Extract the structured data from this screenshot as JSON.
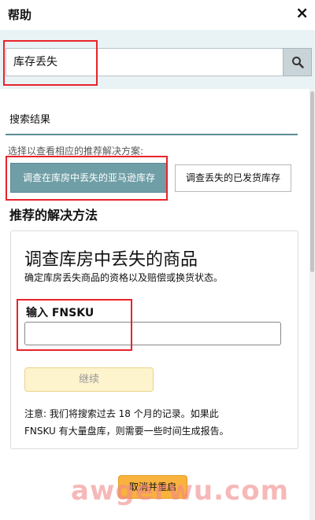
{
  "window": {
    "title": "帮助",
    "close_glyph": "×"
  },
  "search": {
    "value": "库存丢失",
    "icon": "search-icon"
  },
  "results": {
    "label": "搜索结果",
    "hint": "选择以查看相应的推荐解决方案:",
    "options": [
      {
        "label": "调查在库房中丢失的亚马逊库存",
        "selected": true
      },
      {
        "label": "调查丢失的已发货库存",
        "selected": false
      }
    ]
  },
  "solutions": {
    "title": "推荐的解决方法",
    "card": {
      "title": "调查库房中丢失的商品",
      "description": "确定库房丢失商品的资格以及赔偿或换货状态。",
      "field_label": "输入 FNSKU",
      "field_value": "",
      "continue_label": "继续",
      "note_line1": "注意: 我们将搜索过去 18 个月的记录。如果此",
      "note_line2": "FNSKU 有大量盘库，则需要一些时间生成报告。"
    }
  },
  "footer": {
    "cancel_label": "取消并重启"
  },
  "watermark": {
    "text": "awgerwu.com"
  },
  "colors": {
    "accent": "#6f9ea6",
    "highlight_red": "#e8232b",
    "button_yellow": "#f9b23d",
    "search_band": "#e9f2f4"
  }
}
